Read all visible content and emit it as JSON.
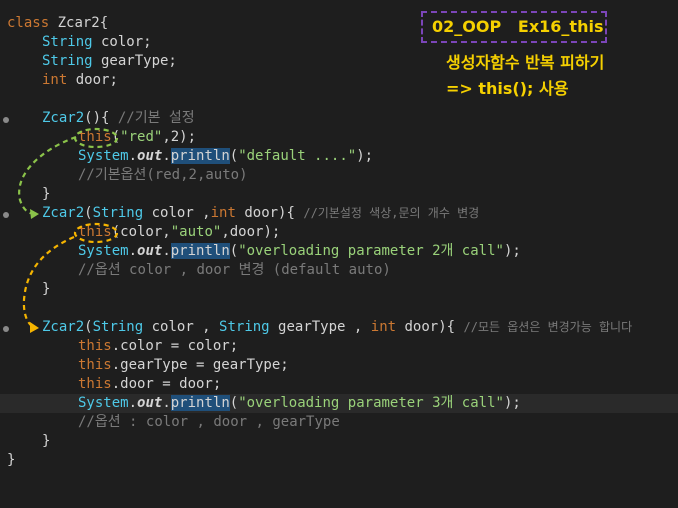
{
  "code": {
    "line1": {
      "kw": "class",
      "name": " Zcar2",
      "brace": "{"
    },
    "line2": {
      "type": "String",
      "name": " color;"
    },
    "line3": {
      "type": "String",
      "name": " gearType;"
    },
    "line4": {
      "type": "int",
      "name": " door;"
    },
    "line6": {
      "ctor": "Zcar2",
      "sig": "(){ ",
      "comment": "//기본 설정"
    },
    "line7": {
      "kw": "this",
      "open": "(",
      "str": "\"red\"",
      "rest": ",2);"
    },
    "line8": {
      "sys": "System",
      "dot1": ".",
      "out": "out",
      "dot2": ".",
      "meth": "println",
      "open": "(",
      "str": "\"default ....\"",
      "close": ");"
    },
    "line9": {
      "comment": "//기본옵션(red,2,auto)"
    },
    "line10": {
      "brace": "}"
    },
    "line11": {
      "ctor": "Zcar2",
      "p1": "(",
      "t1": "String",
      "p2": " color ,",
      "t2": "int",
      "p3": " door){ ",
      "comment": "//기본설정 색상,문의 개수 변경"
    },
    "line12": {
      "kw": "this",
      "p1": "(color,",
      "str": "\"auto\"",
      "p2": ",door);"
    },
    "line13": {
      "sys": "System",
      "dot1": ".",
      "out": "out",
      "dot2": ".",
      "meth": "println",
      "open": "(",
      "str": "\"overloading parameter 2개 call\"",
      "close": ");"
    },
    "line14": {
      "comment": "//옵션 color , door 변경 (default auto)"
    },
    "line15": {
      "brace": "}"
    },
    "line17": {
      "ctor": "Zcar2",
      "p1": "(",
      "t1": "String",
      "p2": " color , ",
      "t2": "String",
      "p3": " gearType , ",
      "t3": "int",
      "p4": " door){ ",
      "comment": "//모든 옵션은 변경가능 합니다"
    },
    "line18": {
      "kw": "this",
      "rest": ".color = color;"
    },
    "line19": {
      "kw": "this",
      "rest": ".gearType = gearType;"
    },
    "line20": {
      "kw": "this",
      "rest": ".door = door;"
    },
    "line21": {
      "sys": "System",
      "dot1": ".",
      "out": "out",
      "dot2": ".",
      "meth": "println",
      "open": "(",
      "str": "\"overloading parameter 3개 call\"",
      "close": ");"
    },
    "line22": {
      "comment": "//옵션 : color , door , gearType"
    },
    "line23": {
      "brace": "}"
    },
    "line24": {
      "brace": "}"
    }
  },
  "annotation": {
    "title": "02_OOP   Ex16_this",
    "line1": "생성자함수 반복 피하기",
    "line2": "=> this(); 사용"
  },
  "colors": {
    "background": "#1e1e1e",
    "keyword": "#cc7832",
    "type": "#4ec9e8",
    "string": "#9ad27a",
    "comment": "#7a7a7a",
    "note": "#f5d000",
    "note_border": "#7b45b8",
    "arrow_green": "#8bc34a",
    "arrow_orange": "#f5b400"
  }
}
